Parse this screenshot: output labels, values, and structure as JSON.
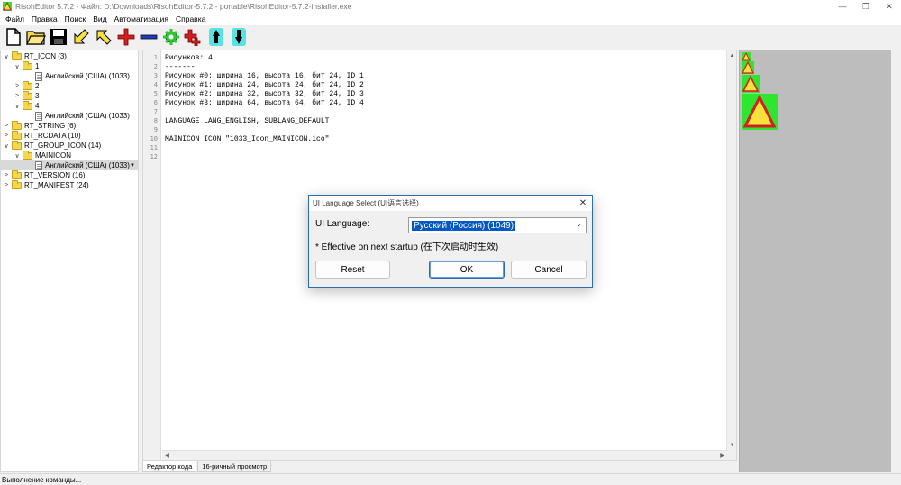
{
  "window": {
    "title": "RisohEditor 5.7.2 - Файл: D:\\Downloads\\RisohEditor-5.7.2 - portable\\RisohEditor-5.7.2-installer.exe",
    "minimize": "—",
    "maximize": "❐",
    "close": "✕"
  },
  "menu": [
    "Файл",
    "Правка",
    "Поиск",
    "Вид",
    "Автоматизация",
    "Справка"
  ],
  "toolbar": [
    "new-file",
    "open-folder",
    "save",
    "arrow-down-left",
    "arrow-up-left",
    "add",
    "delete",
    "gear",
    "wrench-add",
    "ascend",
    "descend"
  ],
  "tree": [
    {
      "label": "RT_ICON (3)",
      "exp": "∨",
      "type": "folder",
      "indent": 0
    },
    {
      "label": "1",
      "exp": "∨",
      "type": "folder",
      "indent": 1
    },
    {
      "label": "Английский (США) (1033)",
      "exp": "",
      "type": "doc",
      "indent": 2
    },
    {
      "label": "2",
      "exp": ">",
      "type": "folder",
      "indent": 1
    },
    {
      "label": "3",
      "exp": ">",
      "type": "folder",
      "indent": 1
    },
    {
      "label": "4",
      "exp": "∨",
      "type": "folder",
      "indent": 1
    },
    {
      "label": "Английский (США) (1033)",
      "exp": "",
      "type": "doc",
      "indent": 2
    },
    {
      "label": "RT_STRING (6)",
      "exp": ">",
      "type": "folder",
      "indent": 0
    },
    {
      "label": "RT_RCDATA (10)",
      "exp": ">",
      "type": "folder",
      "indent": 0
    },
    {
      "label": "RT_GROUP_ICON (14)",
      "exp": "∨",
      "type": "folder",
      "indent": 0
    },
    {
      "label": "MAINICON",
      "exp": "∨",
      "type": "folder",
      "indent": 1
    },
    {
      "label": "Английский (США) (1033)",
      "exp": "",
      "type": "doc",
      "indent": 2,
      "selected": true
    },
    {
      "label": "RT_VERSION (16)",
      "exp": ">",
      "type": "folder",
      "indent": 0
    },
    {
      "label": "RT_MANIFEST (24)",
      "exp": ">",
      "type": "folder",
      "indent": 0
    }
  ],
  "code_lines": [
    "Рисунков: 4",
    "-------",
    "Рисунок #0: ширина 16, высота 16, бит 24, ID 1",
    "Рисунок #1: ширина 24, высота 24, бит 24, ID 2",
    "Рисунок #2: ширина 32, высота 32, бит 24, ID 3",
    "Рисунок #3: ширина 64, высота 64, бит 24, ID 4",
    "",
    "LANGUAGE LANG_ENGLISH, SUBLANG_DEFAULT",
    "",
    "MAINICON ICON \"1033_Icon_MAINICON.ico\"",
    "",
    ""
  ],
  "line_numbers": [
    "1",
    "2",
    "3",
    "4",
    "5",
    "6",
    "7",
    "8",
    "9",
    "10",
    "11",
    "12"
  ],
  "tabs": [
    "Редактор кода",
    "16-ричный просмотр"
  ],
  "status": "Выполнение команды...",
  "dialog": {
    "title": "UI Language Select (UI语言选择)",
    "close": "✕",
    "label": "UI Language:",
    "selected": "Русский (Россия) (1049)",
    "note": "* Effective on next startup (在下次启动时生效)",
    "reset": "Reset",
    "ok": "OK",
    "cancel": "Cancel"
  },
  "colors": {
    "accent": "#2b6cb6",
    "selection": "#0058c6",
    "icon_green": "#2fe62f",
    "icon_yellow": "#f6e23a",
    "icon_red": "#d21f1f"
  }
}
